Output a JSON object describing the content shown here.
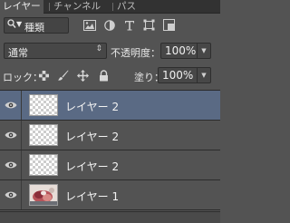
{
  "tabs": [
    {
      "label": "レイヤー",
      "active": true
    },
    {
      "label": "チャンネル",
      "active": false
    },
    {
      "label": "パス",
      "active": false
    }
  ],
  "filter": {
    "kind_label": "種類",
    "icons": [
      "image-filter-icon",
      "adjustment-filter-icon",
      "type-filter-icon",
      "shape-filter-icon",
      "smart-object-filter-icon"
    ]
  },
  "blend": {
    "mode": "通常",
    "opacity_label": "不透明度：",
    "opacity_value": "100%"
  },
  "lock": {
    "label": "ロック：",
    "fill_label": "塗り：",
    "fill_value": "100%"
  },
  "layers": [
    {
      "name": "レイヤー 2",
      "selected": true,
      "thumbnail": "transparent"
    },
    {
      "name": "レイヤー 2",
      "selected": false,
      "thumbnail": "transparent"
    },
    {
      "name": "レイヤー 2",
      "selected": false,
      "thumbnail": "transparent"
    },
    {
      "name": "レイヤー 1",
      "selected": false,
      "thumbnail": "photo"
    }
  ],
  "colors": {
    "panel_bg": "#535353",
    "selected_row": "#5a6a84",
    "tab_bar": "#323232"
  }
}
